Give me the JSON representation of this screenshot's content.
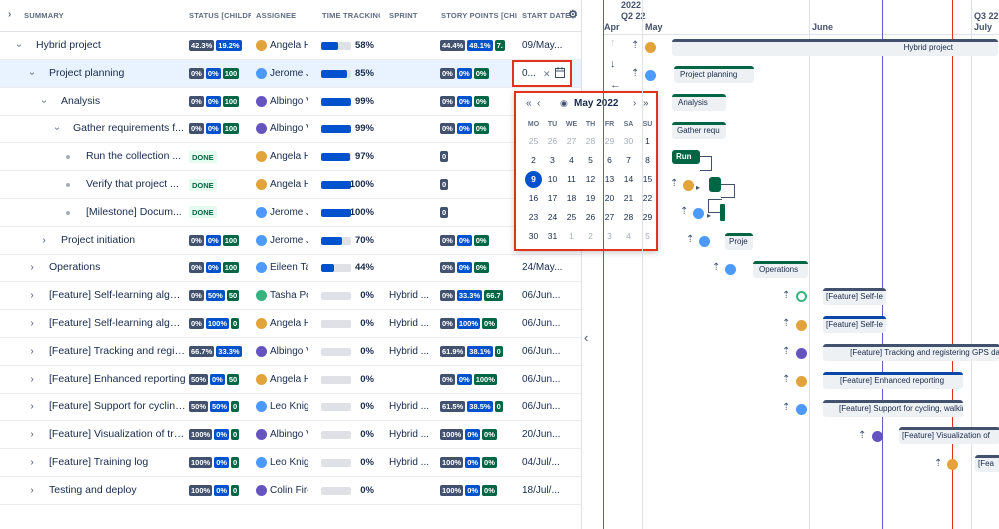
{
  "table": {
    "headers": {
      "summary": "SUMMARY",
      "status": "STATUS [CHILDRE",
      "assignee": "ASSIGNEE",
      "time": "TIME TRACKING (S",
      "sprint": "SPRINT",
      "story": "STORY POINTS [CHILDR",
      "start": "START DATE"
    },
    "rows": [
      {
        "summary": "Hybrid project",
        "status": [
          "42.3%",
          "19.2%"
        ],
        "assignee": "Angela H",
        "time": "58%",
        "time_frac": 0.58,
        "sprint": "",
        "story": [
          "44.4%",
          "48.1%",
          "7."
        ],
        "start": "09/May..."
      },
      {
        "summary": "Project planning",
        "status": [
          "0%",
          "0%",
          "100"
        ],
        "assignee": "Jerome J",
        "time": "85%",
        "time_frac": 0.85,
        "sprint": "",
        "story": [
          "0%",
          "0%",
          "0%"
        ],
        "start": "0..."
      },
      {
        "summary": "Analysis",
        "status": [
          "0%",
          "0%",
          "100"
        ],
        "assignee": "Albingo V",
        "time": "99%",
        "time_frac": 0.99,
        "sprint": "",
        "story": [
          "0%",
          "0%",
          "0%"
        ],
        "start": ""
      },
      {
        "summary": "Gather requirements f...",
        "status": [
          "0%",
          "0%",
          "100"
        ],
        "assignee": "Albingo V",
        "time": "99%",
        "time_frac": 0.99,
        "sprint": "",
        "story": [
          "0%",
          "0%",
          "0%"
        ],
        "start": ""
      },
      {
        "summary": "Run the collection ...",
        "status": [
          "DONE"
        ],
        "assignee": "Angela H",
        "time": "97%",
        "time_frac": 0.97,
        "sprint": "",
        "story": [
          "0"
        ],
        "start": ""
      },
      {
        "summary": "Verify that project ...",
        "status": [
          "DONE"
        ],
        "assignee": "Angela H",
        "time": "100%",
        "time_frac": 1.0,
        "sprint": "",
        "story": [
          "0"
        ],
        "start": ""
      },
      {
        "summary": "[Milestone] Docum...",
        "status": [
          "DONE"
        ],
        "assignee": "Jerome J",
        "time": "100%",
        "time_frac": 1.0,
        "sprint": "",
        "story": [
          "0"
        ],
        "start": ""
      },
      {
        "summary": "Project initiation",
        "status": [
          "0%",
          "0%",
          "100"
        ],
        "assignee": "Jerome J",
        "time": "70%",
        "time_frac": 0.7,
        "sprint": "",
        "story": [
          "0%",
          "0%",
          "0%"
        ],
        "start": ""
      },
      {
        "summary": "Operations",
        "status": [
          "0%",
          "0%",
          "100"
        ],
        "assignee": "Eileen Ta",
        "time": "44%",
        "time_frac": 0.44,
        "sprint": "",
        "story": [
          "0%",
          "0%",
          "0%"
        ],
        "start": "24/May..."
      },
      {
        "summary": "[Feature] Self-learning algori...",
        "status": [
          "0%",
          "50%",
          "50"
        ],
        "assignee": "Tasha Po",
        "time": "0%",
        "time_frac": 0,
        "sprint": "Hybrid ...",
        "story": [
          "0%",
          "33.3%",
          "66.7"
        ],
        "start": "06/Jun..."
      },
      {
        "summary": "[Feature] Self-learning algori...",
        "status": [
          "0%",
          "100%",
          "0"
        ],
        "assignee": "Angela H",
        "time": "0%",
        "time_frac": 0,
        "sprint": "Hybrid ...",
        "story": [
          "0%",
          "100%",
          "0%"
        ],
        "start": "06/Jun..."
      },
      {
        "summary": "[Feature] Tracking and regist...",
        "status": [
          "66.7%",
          "33.3%"
        ],
        "assignee": "Albingo V",
        "time": "0%",
        "time_frac": 0,
        "sprint": "Hybrid ...",
        "story": [
          "61.9%",
          "38.1%",
          "0"
        ],
        "start": "06/Jun..."
      },
      {
        "summary": "[Feature] Enhanced reporting",
        "status": [
          "50%",
          "0%",
          "50"
        ],
        "assignee": "Angela H",
        "time": "0%",
        "time_frac": 0,
        "sprint": "",
        "story": [
          "0%",
          "0%",
          "100%"
        ],
        "start": "06/Jun..."
      },
      {
        "summary": "[Feature] Support for cycling...",
        "status": [
          "50%",
          "50%",
          "0"
        ],
        "assignee": "Leo Knigh",
        "time": "0%",
        "time_frac": 0,
        "sprint": "Hybrid ...",
        "story": [
          "61.5%",
          "38.5%",
          "0"
        ],
        "start": "06/Jun..."
      },
      {
        "summary": "[Feature] Visualization of tra...",
        "status": [
          "100%",
          "0%",
          "0"
        ],
        "assignee": "Albingo V",
        "time": "0%",
        "time_frac": 0,
        "sprint": "Hybrid ...",
        "story": [
          "100%",
          "0%",
          "0%"
        ],
        "start": "20/Jun..."
      },
      {
        "summary": "[Feature] Training log",
        "status": [
          "100%",
          "0%",
          "0"
        ],
        "assignee": "Leo Knigh",
        "time": "0%",
        "time_frac": 0,
        "sprint": "Hybrid ...",
        "story": [
          "100%",
          "0%",
          "0%"
        ],
        "start": "04/Jul/..."
      },
      {
        "summary": "Testing and deploy",
        "status": [
          "100%",
          "0%",
          "0"
        ],
        "assignee": "Colin Fire",
        "time": "0%",
        "time_frac": 0,
        "sprint": "",
        "story": [
          "100%",
          "0%",
          "0%"
        ],
        "start": "18/Jul/..."
      }
    ]
  },
  "date_editor": {
    "value": "0...",
    "clear": "✕",
    "calendar_icon": "calendar-icon"
  },
  "calendar": {
    "title": "May 2022",
    "dow": [
      "MO",
      "TU",
      "WE",
      "TH",
      "FR",
      "SA",
      "SU"
    ],
    "weeks": [
      [
        "25",
        "26",
        "27",
        "28",
        "29",
        "30",
        "1"
      ],
      [
        "2",
        "3",
        "4",
        "5",
        "6",
        "7",
        "8"
      ],
      [
        "9",
        "10",
        "11",
        "12",
        "13",
        "14",
        "15"
      ],
      [
        "16",
        "17",
        "18",
        "19",
        "20",
        "21",
        "22"
      ],
      [
        "23",
        "24",
        "25",
        "26",
        "27",
        "28",
        "29"
      ],
      [
        "30",
        "31",
        "1",
        "2",
        "3",
        "4",
        "5"
      ]
    ]
  },
  "gantt": {
    "year": "2022",
    "quarter": "Q2 22",
    "quarter2": "Q3 22",
    "months": [
      "Apr",
      "May",
      "June",
      "July"
    ],
    "bars": {
      "hybrid": "Hybrid project",
      "planning": "Project planning",
      "analysis": "Analysis",
      "gather": "Gather requ",
      "run": "Run",
      "initiation": "Proje",
      "operations": "Operations",
      "f1": "[Feature] Self-le",
      "f2": "[Feature] Self-le",
      "f3": "[Feature] Tracking and registering GPS da",
      "f4": "[Feature] Enhanced reporting",
      "f5": "[Feature] Support for cycling, walkin",
      "f6": "[Feature] Visualization of",
      "f7": "[Fea"
    }
  }
}
